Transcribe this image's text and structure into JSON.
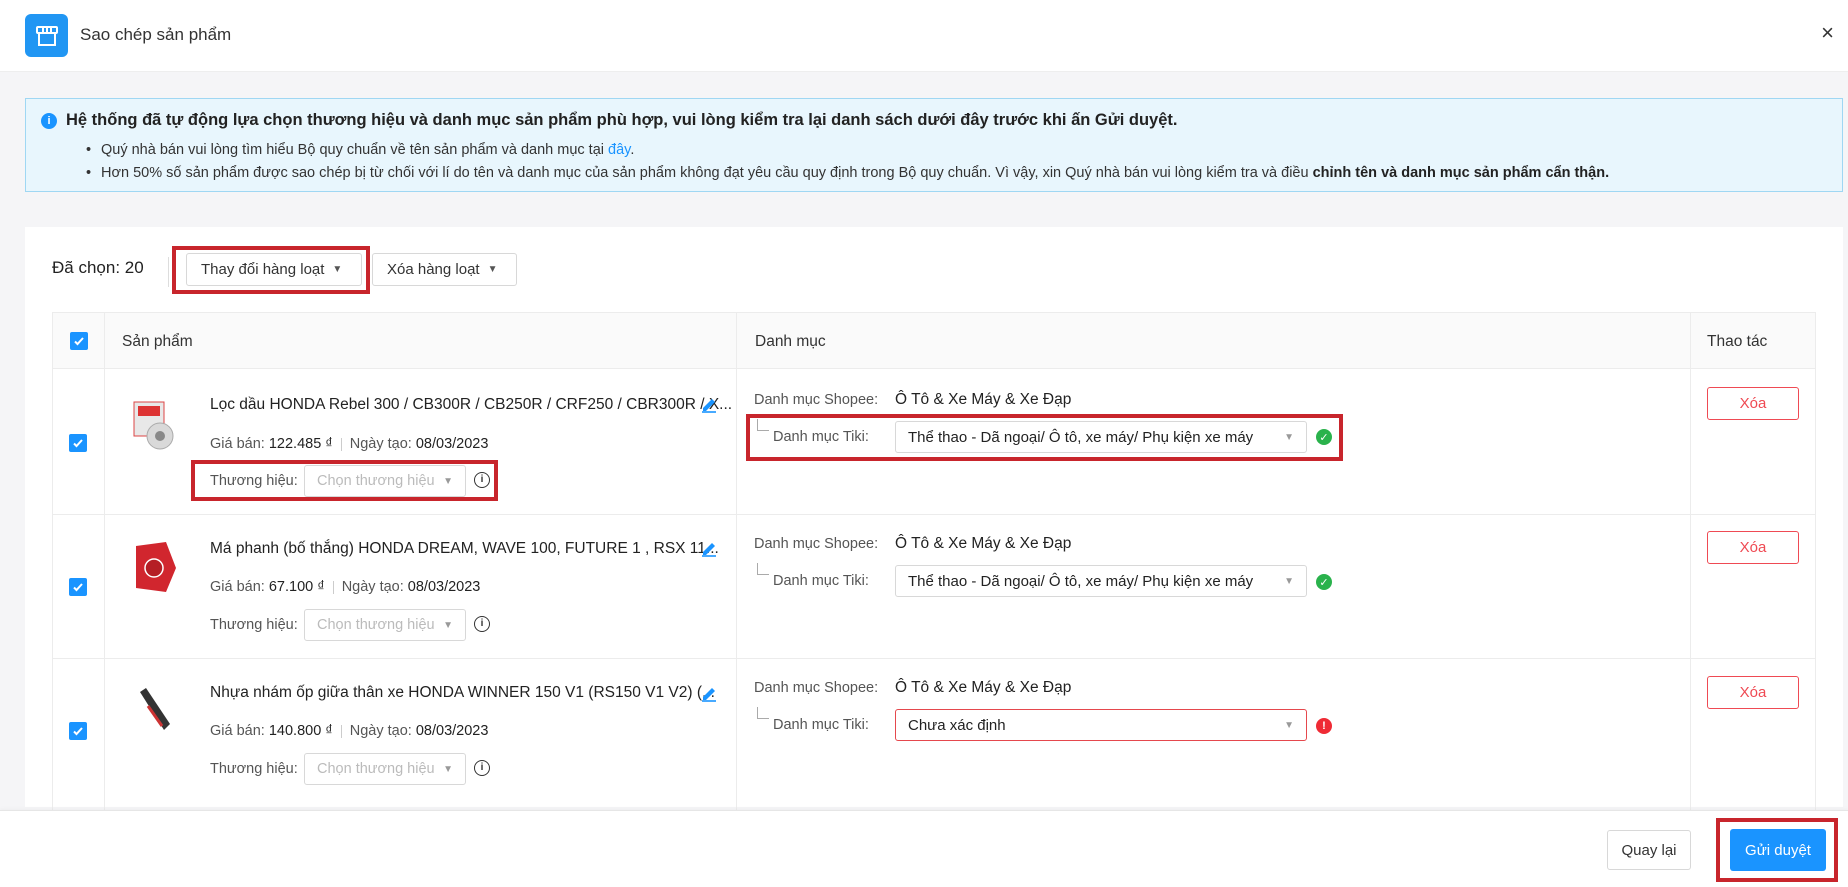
{
  "header": {
    "title": "Sao chép sản phẩm",
    "close_label": "×"
  },
  "notice": {
    "headline": "Hệ thống đã tự động lựa chọn thương hiệu và danh mục sản phẩm phù hợp, vui lòng kiểm tra lại danh sách dưới đây trước khi ấn Gửi duyệt.",
    "line1_text": "Quý nhà bán vui lòng tìm hiểu Bộ quy chuẩn về tên sản phẩm và danh mục tại ",
    "line1_link": "đây",
    "line1_end": ".",
    "line2_text": "Hơn 50% số sản phẩm được sao chép bị từ chối với lí do tên và danh mục của sản phẩm không đạt yêu cầu quy định trong Bộ quy chuẩn. Vì vậy, xin Quý nhà bán vui lòng kiểm tra và điều ",
    "line2_bold": "chỉnh tên và danh mục sản phẩm cẩn thận."
  },
  "toolbar": {
    "selected_label": "Đã chọn: 20",
    "bulk_change_label": "Thay đổi hàng loạt",
    "bulk_delete_label": "Xóa hàng loạt"
  },
  "table": {
    "col_product": "Sản phẩm",
    "col_category": "Danh mục",
    "col_action": "Thao tác",
    "price_label": "Giá bán:",
    "created_label": "Ngày tạo:",
    "brand_label": "Thương hiệu:",
    "brand_placeholder": "Chọn thương hiệu",
    "shopee_label": "Danh mục Shopee:",
    "tiki_label": "Danh mục Tiki:",
    "delete_label": "Xóa",
    "rows": [
      {
        "name": "Lọc dầu HONDA Rebel 300 / CB300R / CB250R / CRF250 / CBR300R / X...",
        "price": "122.485 ₫",
        "created": "08/03/2023",
        "shopee_category": "Ô Tô & Xe Máy & Xe Đạp",
        "tiki_category": "Thể thao - Dã ngoại/ Ô tô, xe máy/ Phụ kiện xe máy",
        "status": "ok"
      },
      {
        "name": "Má phanh (bố thắng) HONDA DREAM, WAVE 100, FUTURE 1 , RSX 11...",
        "price": "67.100 ₫",
        "created": "08/03/2023",
        "shopee_category": "Ô Tô & Xe Máy & Xe Đạp",
        "tiki_category": "Thể thao - Dã ngoại/ Ô tô, xe máy/ Phụ kiện xe máy",
        "status": "ok"
      },
      {
        "name": "Nhựa nhám ốp giữa thân xe HONDA WINNER 150 V1 (RS150 V1 V2) (...",
        "price": "140.800 ₫",
        "created": "08/03/2023",
        "shopee_category": "Ô Tô & Xe Máy & Xe Đạp",
        "tiki_category": "Chưa xác định",
        "status": "error"
      }
    ]
  },
  "footer": {
    "back_label": "Quay lại",
    "submit_label": "Gửi duyệt"
  },
  "colors": {
    "accent": "#1a94ff",
    "danger": "#ef4a53",
    "success": "#2ab24c",
    "highlight_box": "#c8252c"
  }
}
